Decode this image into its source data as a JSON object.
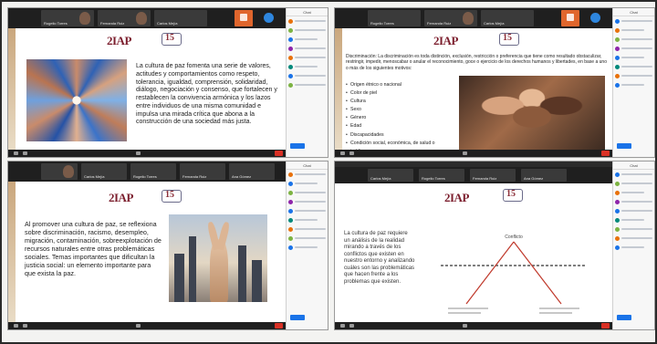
{
  "panels": [
    {
      "participants": [
        "Rogelio Torres",
        "Fernanda Ruiz",
        "Carlos Mejía"
      ],
      "sidebar_title": "Chat",
      "slide_text": "La cultura de paz fomenta una serie de valores, actitudes y comportamientos como respeto, tolerancia, igualdad, comprensión, solidaridad, diálogo, negociación y consenso, que fortalecen y restablecen la convivencia armónica y los lazos entre individuos de una misma comunidad e impulsa una mirada crítica que abona a la construcción de una sociedad más justa."
    },
    {
      "participants": [
        "Rogelio Torres",
        "Fernanda Ruiz",
        "Carlos Mejía"
      ],
      "sidebar_title": "Chat",
      "slide_text": "Discriminación: La discriminación es toda distinción, exclusión, restricción o preferencia que tiene como resultado obstaculizar, restringir, impedir, menoscabar o anular el reconocimiento, goce o ejercicio de los derechos humanos y libertades, en base a uno o más de los siguientes motivos:",
      "list": [
        "Origen étnico o nacional",
        "Color de piel",
        "Cultura",
        "Sexo",
        "Género",
        "Edad",
        "Discapacidades",
        "Condición social, económica, de salud o jurídica"
      ]
    },
    {
      "participants": [
        "Carlos Mejía",
        "Rogelio Torres",
        "Fernanda Ruiz",
        "Ana Gómez"
      ],
      "sidebar_title": "Chat",
      "slide_text": "Al promover una cultura de paz, se reflexiona sobre discriminación, racismo, desempleo, migración, contaminación, sobreexplotación de recursos naturales entre otras problemáticas sociales. Temas importantes que dificultan la justicia social: un elemento importante para que exista la paz."
    },
    {
      "participants": [
        "Carlos Mejía",
        "Rogelio Torres",
        "Fernanda Ruiz",
        "Ana Gómez"
      ],
      "sidebar_title": "Chat",
      "slide_text": "La cultura de paz requiere un análisis de la realidad mirando a través de los conflictos que existen en nuestro entorno y analizando cuáles son las problemáticas que hacen frente a los problemas que existen.",
      "diagram_label": "Conflicto"
    }
  ],
  "logo_text": "2IAP",
  "seal_text": "15",
  "colors": {
    "brand": "#7c1f2e",
    "zoom_bar": "#1f1f1f",
    "accent": "#1a73e8",
    "end": "#d93025"
  }
}
